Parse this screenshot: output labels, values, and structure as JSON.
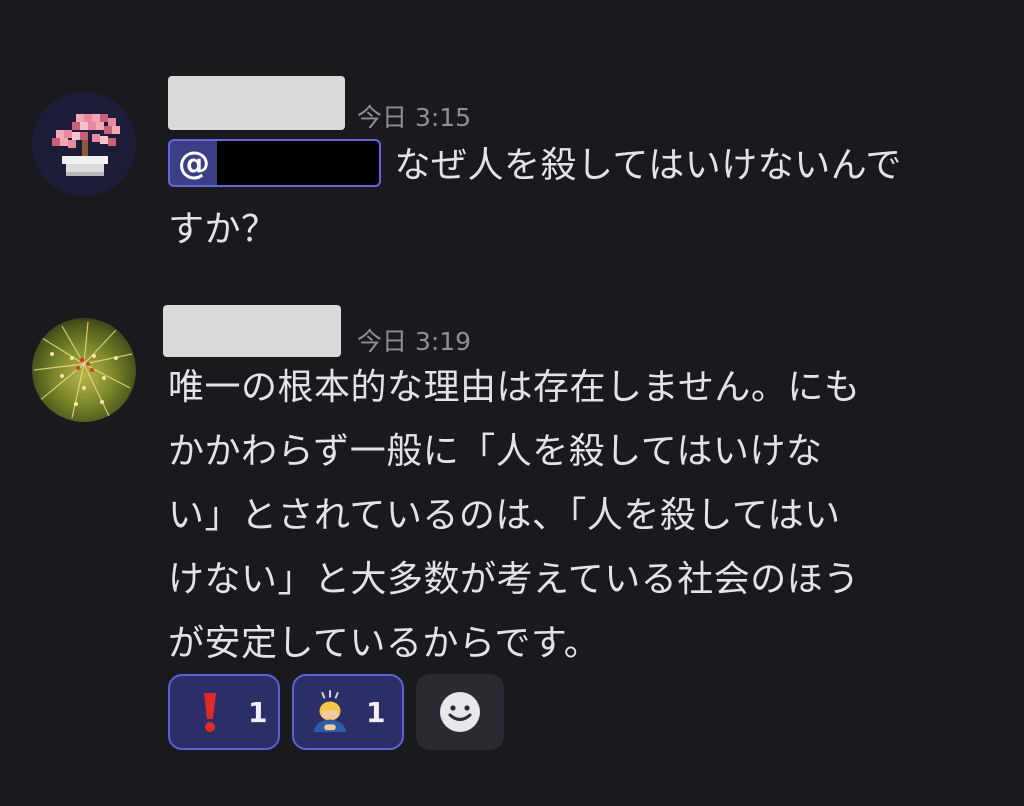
{
  "messages": [
    {
      "timestamp": "今日 3:15",
      "mention_prefix": "@",
      "lines": [
        "なぜ人を殺してはいけないんで",
        "すか？"
      ]
    },
    {
      "timestamp": "今日 3:19",
      "lines": [
        "唯一の根本的な理由は存在しません。にも",
        "かかわらず一般に「人を殺してはいけな",
        "い」とされているのは、「人を殺してはい",
        "けない」と大多数が考えている社会のほう",
        "が安定しているからです。"
      ],
      "reactions": [
        {
          "emoji": "exclamation-icon",
          "count": "1"
        },
        {
          "emoji": "bowing-person-icon",
          "count": "1"
        }
      ]
    }
  ],
  "colors": {
    "background": "#1a1a1e",
    "text": "#e3e3e6",
    "timestamp": "#8e8e96",
    "mention_bg": "#3d3f86",
    "mention_border": "#6267d8",
    "reaction_bg": "#2c2e68",
    "reaction_border": "#5c61d4"
  }
}
